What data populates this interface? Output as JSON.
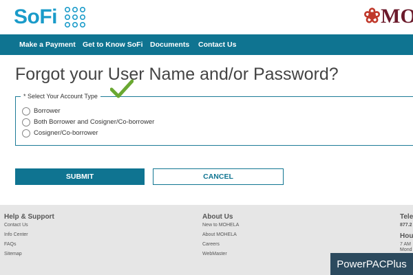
{
  "header": {
    "brand": "SoFi",
    "partner_brand_prefix": "",
    "partner_brand": "MO"
  },
  "nav": {
    "items": [
      {
        "label": "Make a Payment"
      },
      {
        "label": "Get to Know SoFi"
      },
      {
        "label": "Documents"
      },
      {
        "label": "Contact Us"
      }
    ]
  },
  "main": {
    "title": "Forgot your User Name and/or Password?",
    "account_type": {
      "legend": "* Select Your Account Type",
      "options": [
        {
          "label": "Borrower",
          "selected": false
        },
        {
          "label": "Both Borrower and Cosigner/Co-borrower",
          "selected": false
        },
        {
          "label": "Cosigner/Co-borrower",
          "selected": false
        }
      ]
    },
    "submit_label": "SUBMIT",
    "cancel_label": "CANCEL"
  },
  "footer": {
    "help": {
      "heading": "Help & Support",
      "links": [
        "Contact Us",
        "Info Center",
        "FAQs",
        "Sitemap"
      ]
    },
    "about": {
      "heading": "About Us",
      "links": [
        "New to MOHELA",
        "About MOHELA",
        "Careers",
        "WebMaster"
      ]
    },
    "tele": {
      "heading": "Tele",
      "line1": "877.2"
    },
    "hours": {
      "heading": "Hou",
      "line1": "7 AM -",
      "line2": "Mond"
    }
  },
  "watermark": "PowerPACPlus",
  "colors": {
    "brand_blue": "#1a9bc9",
    "nav_teal": "#0f7491",
    "check_green": "#6aa832",
    "footer_bg": "#e6e6e6"
  }
}
